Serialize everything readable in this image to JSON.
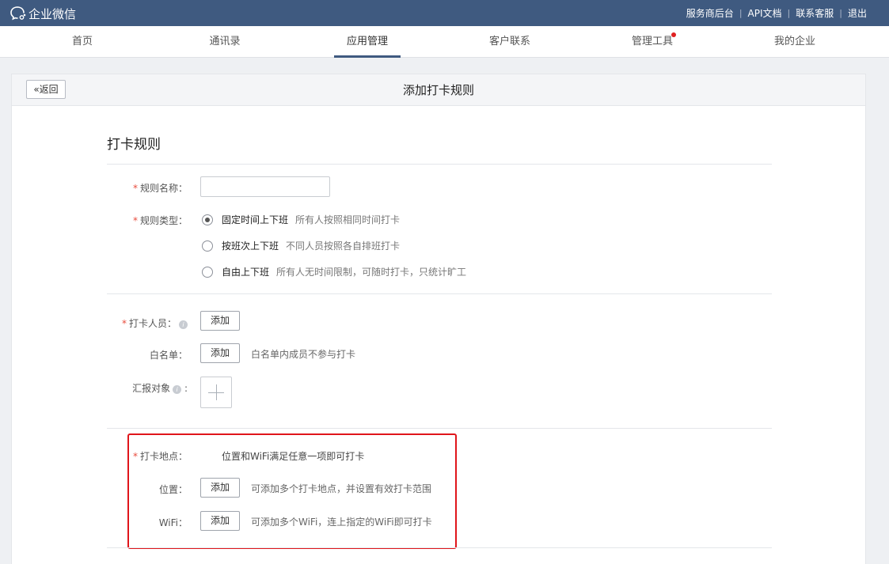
{
  "app": {
    "name": "企业微信"
  },
  "toplinks": [
    "服务商后台",
    "API文档",
    "联系客服",
    "退出"
  ],
  "nav": {
    "items": [
      "首页",
      "通讯录",
      "应用管理",
      "客户联系",
      "管理工具",
      "我的企业"
    ],
    "active": "应用管理"
  },
  "page": {
    "back_label": "返回",
    "title": "添加打卡规则",
    "section_title": "打卡规则"
  },
  "form": {
    "rule_name": {
      "label": "规则名称：",
      "value": ""
    },
    "rule_type": {
      "label": "规则类型：",
      "options": [
        {
          "label": "固定时间上下班",
          "desc": "所有人按照相同时间打卡",
          "checked": true
        },
        {
          "label": "按班次上下班",
          "desc": "不同人员按照各自排班打卡",
          "checked": false
        },
        {
          "label": "自由上下班",
          "desc": "所有人无时间限制，可随时打卡，只统计旷工",
          "checked": false
        }
      ]
    },
    "members": {
      "label": "打卡人员：",
      "button": "添加"
    },
    "whitelist": {
      "label": "白名单：",
      "button": "添加",
      "hint": "白名单内成员不参与打卡"
    },
    "report_to": {
      "label": "汇报对象"
    },
    "location": {
      "label": "打卡地点：",
      "hint": "位置和WiFi满足任意一项即可打卡",
      "position": {
        "label": "位置：",
        "button": "添加",
        "hint": "可添加多个打卡地点，并设置有效打卡范围"
      },
      "wifi": {
        "label": "WiFi：",
        "button": "添加",
        "hint": "可添加多个WiFi，连上指定的WiFi即可打卡"
      }
    }
  },
  "colors": {
    "topbar": "#3f5a80",
    "required": "#e84c3d",
    "highlight": "#e0151b",
    "badge": "#e02020"
  }
}
